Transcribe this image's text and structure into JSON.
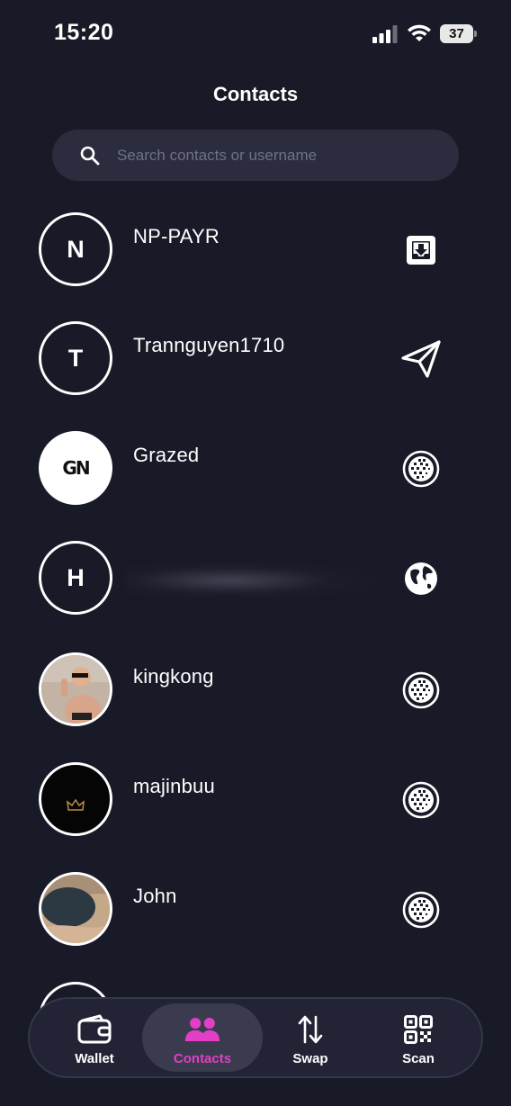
{
  "status_bar": {
    "time": "15:20",
    "battery": "37"
  },
  "page": {
    "title": "Contacts"
  },
  "search": {
    "placeholder": "Search contacts or username"
  },
  "contacts": [
    {
      "initial": "N",
      "name": "NP-PAYR",
      "action_icon": "inbox-download-icon"
    },
    {
      "initial": "T",
      "name": "Trannguyen1710",
      "action_icon": "send-plane-icon"
    },
    {
      "initial": "GN",
      "name": "Grazed",
      "action_icon": "network-globe-icon"
    },
    {
      "initial": "H",
      "name": "",
      "action_icon": "globe-icon"
    },
    {
      "initial": "",
      "name": "kingkong",
      "action_icon": "network-globe-icon"
    },
    {
      "initial": "",
      "name": "majinbuu",
      "action_icon": "network-globe-icon"
    },
    {
      "initial": "",
      "name": "John",
      "action_icon": "network-globe-icon"
    }
  ],
  "tabs": [
    {
      "label": "Wallet",
      "icon": "wallet-icon",
      "active": false
    },
    {
      "label": "Contacts",
      "icon": "contacts-icon",
      "active": true
    },
    {
      "label": "Swap",
      "icon": "swap-icon",
      "active": false
    },
    {
      "label": "Scan",
      "icon": "qr-scan-icon",
      "active": false
    }
  ],
  "colors": {
    "background": "#191a27",
    "accent": "#e23fc6",
    "search_bg": "#2b2c3d"
  }
}
